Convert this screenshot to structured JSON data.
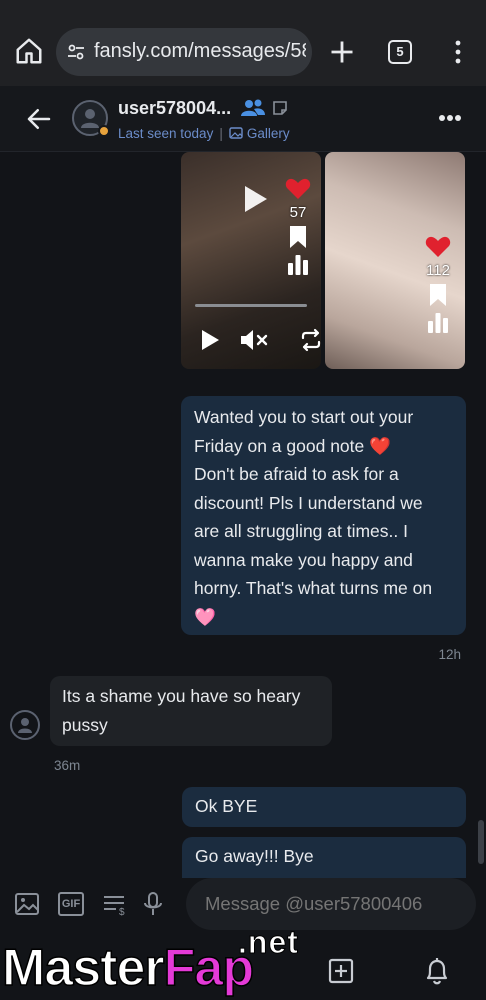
{
  "browser": {
    "url": "fansly.com/messages/58",
    "tab_count": "5"
  },
  "chat": {
    "username": "user578004...",
    "last_seen": "Last seen today",
    "separator": "|",
    "gallery_label": "Gallery"
  },
  "media": {
    "tile1_likes": "57",
    "tile2_likes": "112"
  },
  "messages": {
    "outgoing_main": {
      "line1": "Wanted you to start out your",
      "line2": "Friday on a good note",
      "emoji_heart": "❤️",
      "line3": "Don't be afraid to ask for a",
      "line4": "discount! Pls I understand we",
      "line5": "are all struggling at times.. I",
      "line6": "wanna make you happy and",
      "line7": "horny. That's what turns me on",
      "emoji_pink_heart": "🩷",
      "time": "12h"
    },
    "incoming": {
      "line1": "Its a shame you have so heary",
      "line2": "pussy",
      "time": "36m"
    },
    "ok_bye": "Ok BYE",
    "go_away": "Go away!!! Bye"
  },
  "composer": {
    "placeholder": "Message @user57800406",
    "gif_label": "GIF"
  },
  "watermark": {
    "main_left": "Master",
    "main_right": "Fap",
    "suffix": ".net"
  },
  "colors": {
    "accent_blue": "#6b8cc9",
    "outgoing_bubble": "#1b2c3f",
    "incoming_bubble": "#1f2226",
    "like_heart": "#e0212e",
    "watermark_pink": "#e43ad7"
  }
}
